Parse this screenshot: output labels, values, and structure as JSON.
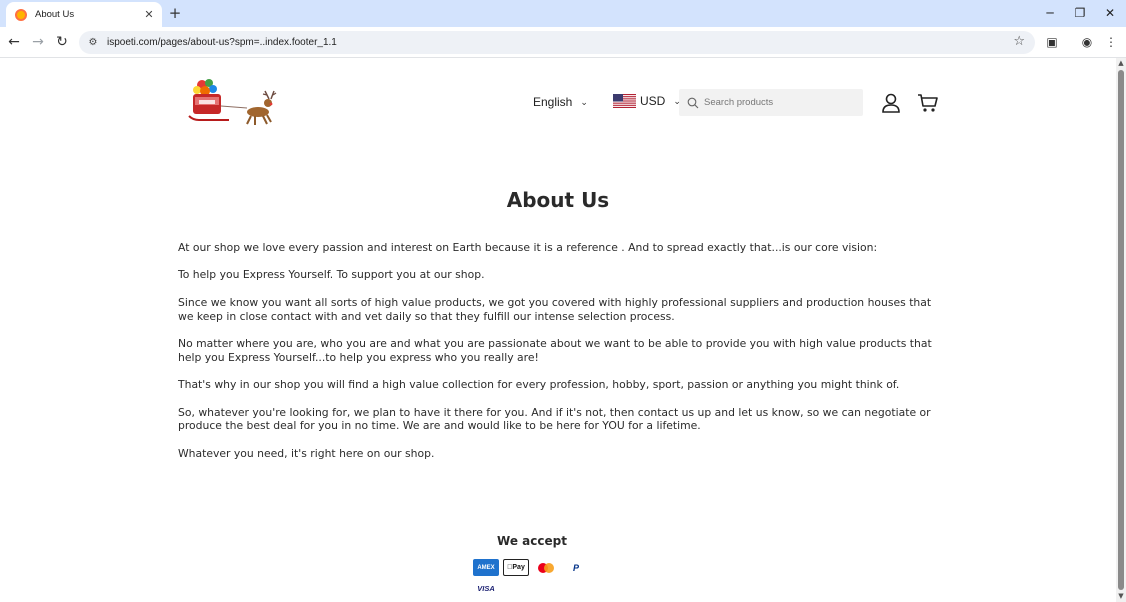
{
  "browser": {
    "tab_title": "About Us",
    "url": "ispoeti.com/pages/about-us?spm=..index.footer_1.1"
  },
  "header": {
    "language": "English",
    "currency": "USD",
    "search_placeholder": "Search products"
  },
  "page": {
    "title": "About Us",
    "paragraphs": [
      "At our shop we love every passion and interest on Earth because it is a reference . And to spread exactly that...is our core vision:",
      "To help you Express Yourself. To support you at our shop.",
      "Since we know you want all sorts of high value products, we got you covered with highly professional suppliers and production houses that we keep in close contact with and vet daily so that they fulfill our intense selection process.",
      "No matter where you are, who you are and what you are passionate about we want to be able to provide you with high value products that help you Express Yourself...to help you express who you really are!",
      "That's why in our shop you will find a high value collection for every profession, hobby, sport, passion or anything you might think of.",
      "So, whatever you're looking for, we plan to have it there for you. And if it's not, then contact us up and let us know, so we can negotiate or produce the best deal for you in no time. We are and would like to be here for YOU for a lifetime.",
      "Whatever you need, it's right here on our shop."
    ]
  },
  "footer": {
    "accept_title": "We accept",
    "payment_methods": [
      {
        "name": "amex-icon",
        "label": "AMEX"
      },
      {
        "name": "applepay-icon",
        "label": "Pay"
      },
      {
        "name": "mastercard-icon",
        "label": ""
      },
      {
        "name": "paypal-icon",
        "label": "P"
      },
      {
        "name": "visa-icon",
        "label": "VISA"
      }
    ]
  },
  "colors": {
    "tabbar": "#d3e3fd",
    "amex": "#1f72cd",
    "mastercard_red": "#eb001b",
    "mastercard_yellow": "#f79e1b",
    "paypal": "#003087",
    "visa": "#1a1f71"
  }
}
